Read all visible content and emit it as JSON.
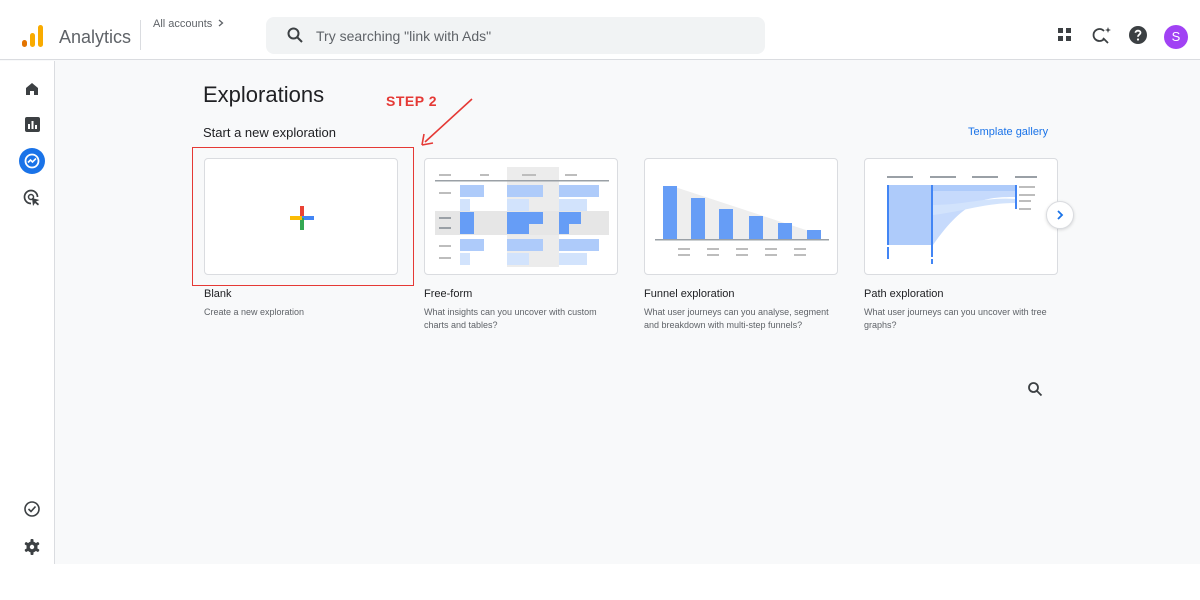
{
  "header": {
    "app_name": "Analytics",
    "account_label": "All accounts",
    "search_placeholder": "Try searching \"link with Ads\"",
    "avatar_initial": "S",
    "icons": [
      "apps-grid-icon",
      "search-insights-icon",
      "help-icon"
    ]
  },
  "sidebar": {
    "items": [
      {
        "name": "home",
        "icon": "home-icon"
      },
      {
        "name": "reports",
        "icon": "bar-chart-icon"
      },
      {
        "name": "explore",
        "icon": "explore-icon",
        "active": true
      },
      {
        "name": "advertising",
        "icon": "target-icon"
      }
    ],
    "bottom_items": [
      {
        "name": "admin-check",
        "icon": "check-circle-icon"
      },
      {
        "name": "settings",
        "icon": "gear-icon"
      }
    ]
  },
  "main": {
    "title": "Explorations",
    "subtitle": "Start a new exploration",
    "template_link": "Template gallery",
    "cards": [
      {
        "title": "Blank",
        "desc": "Create a new exploration"
      },
      {
        "title": "Free-form",
        "desc": "What insights can you uncover with custom charts and tables?"
      },
      {
        "title": "Funnel exploration",
        "desc": "What user journeys can you analyse, segment and breakdown with multi-step funnels?"
      },
      {
        "title": "Path exploration",
        "desc": "What user journeys can you uncover with tree graphs?"
      }
    ]
  },
  "annotation": {
    "step_label": "STEP 2"
  },
  "colors": {
    "accent": "#1a73e8",
    "annotation": "#e53935",
    "avatar": "#a142f4"
  }
}
